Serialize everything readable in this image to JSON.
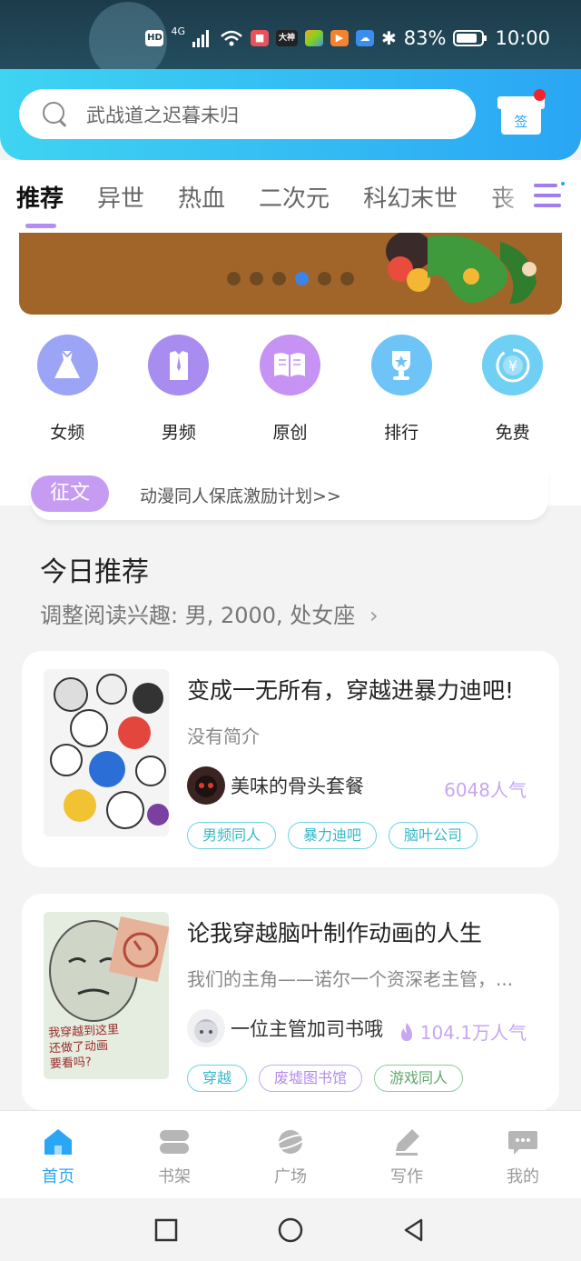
{
  "status_bar": {
    "network": "4G",
    "battery": "83%",
    "time": "10:00"
  },
  "search": {
    "placeholder": "武战道之迟暮未归"
  },
  "checkin": {
    "label": "签"
  },
  "tabs": [
    "推荐",
    "异世",
    "热血",
    "二次元",
    "科幻末世",
    "丧"
  ],
  "banner": {
    "dots": 6,
    "active_dot": 4
  },
  "categories": [
    {
      "label": "女频",
      "icon": "dress-icon",
      "color": "#9ca4f6"
    },
    {
      "label": "男频",
      "icon": "shirt-icon",
      "color": "#a88cf0"
    },
    {
      "label": "原创",
      "icon": "book-icon",
      "color": "#c692f3"
    },
    {
      "label": "排行",
      "icon": "trophy-icon",
      "color": "#6ec4f6"
    },
    {
      "label": "免费",
      "icon": "yen-coin-icon",
      "color": "#6fd0f4"
    }
  ],
  "notice": {
    "tag": "征文",
    "text": "动漫同人保底激励计划>>"
  },
  "section": {
    "title": "今日推荐",
    "subtitle": "调整阅读兴趣: 男, 2000, 处女座"
  },
  "books": [
    {
      "title": "变成一无所有，穿越进暴力迪吧!",
      "desc": "没有简介",
      "author": "美味的骨头套餐",
      "popularity": "6048人气",
      "tags": [
        "男频同人",
        "暴力迪吧",
        "脑叶公司"
      ]
    },
    {
      "title": "论我穿越脑叶制作动画的人生",
      "desc": "我们的主角——诺尔一个资深老主管，...",
      "author": "一位主管加司书哦",
      "popularity": "104.1万人气",
      "tags": [
        "穿越",
        "废墟图书馆",
        "游戏同人"
      ],
      "cover_text": "我穿越到这里\n还做了动画\n要看吗?"
    }
  ],
  "bottom_nav": [
    {
      "label": "首页",
      "icon": "home-icon",
      "active": true
    },
    {
      "label": "书架",
      "icon": "bookshelf-icon",
      "active": false
    },
    {
      "label": "广场",
      "icon": "planet-icon",
      "active": false
    },
    {
      "label": "写作",
      "icon": "pen-icon",
      "active": false
    },
    {
      "label": "我的",
      "icon": "chat-bubble-icon",
      "active": false
    }
  ],
  "colors": {
    "accent": "#2aa6f4",
    "purple": "#b38ef2"
  }
}
